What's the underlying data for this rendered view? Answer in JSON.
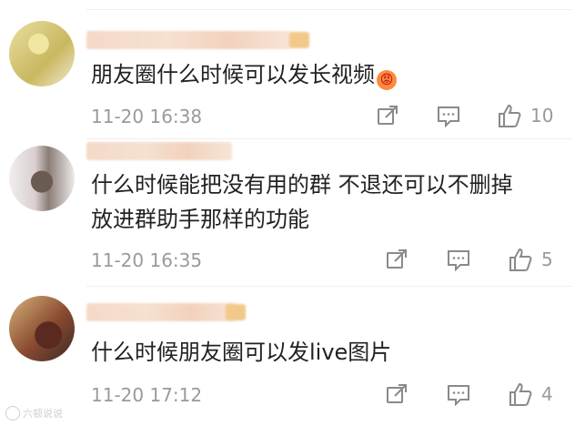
{
  "comments": [
    {
      "text": "朋友圈什么时候可以发长视频",
      "emoji": "😡",
      "time": "11-20 16:38",
      "likes": "10"
    },
    {
      "text": "什么时候能把没有用的群 不退还可以不删掉 放进群助手那样的功能",
      "time": "11-20 16:35",
      "likes": "5"
    },
    {
      "text": "什么时候朋友圈可以发live图片",
      "time": "11-20 17:12",
      "likes": "4"
    }
  ],
  "icons": {
    "share": "share-icon",
    "comment": "comment-icon",
    "like": "thumbs-up-icon"
  },
  "watermark": "六顿说说"
}
